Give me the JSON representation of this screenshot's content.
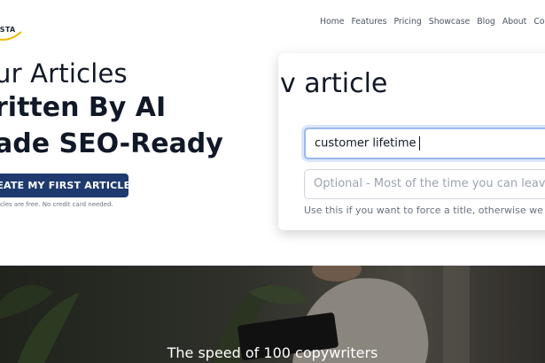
{
  "header": {
    "logo_text": "ESTA",
    "nav": [
      "Home",
      "Features",
      "Pricing",
      "Showcase",
      "Blog",
      "About",
      "Conta"
    ]
  },
  "hero": {
    "line1": "ur Articles",
    "line2": "ritten By AI",
    "line3": "ade SEO-Ready",
    "cta_label": "REATE MY FIRST ARTICLE",
    "cta_note": "icles are free. No credit card needed."
  },
  "form_card": {
    "title": "v article",
    "keyword_value": "customer lifetime",
    "title_placeholder": "Optional - Most of the time you can leave",
    "help_text": "Use this if you want to force a title, otherwise we"
  },
  "band": {
    "tagline": "The speed of 100 copywriters"
  },
  "colors": {
    "cta_bg": "#1e3a6e",
    "focus_border": "#9ab8ee",
    "logo_accent": "#f2b705"
  }
}
